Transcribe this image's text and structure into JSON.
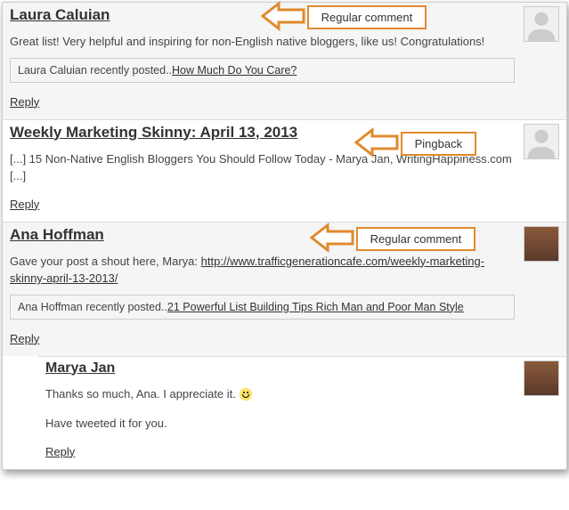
{
  "comments": [
    {
      "author": "Laura Caluian",
      "body": "Great list! Very helpful and inspiring for non-English native bloggers, like us! Congratulations!",
      "recent_prefix": "Laura Caluian recently posted..",
      "recent_link": "How Much Do You Care?",
      "reply": "Reply",
      "avatar": "blank",
      "callout": "Regular comment"
    },
    {
      "author": "Weekly Marketing Skinny: April 13, 2013",
      "body": "[...] 15 Non-Native English Bloggers You Should Follow Today - Marya Jan, WritingHappiness.com [...]",
      "reply": "Reply",
      "avatar": "blank",
      "callout": "Pingback"
    },
    {
      "author": "Ana Hoffman",
      "body_pre": "Gave your post a shout here, Marya: ",
      "body_link": "http://www.trafficgenerationcafe.com/weekly-marketing-skinny-april-13-2013/",
      "recent_prefix": "Ana Hoffman recently posted..",
      "recent_link": "21 Powerful List Building Tips Rich Man and Poor Man Style",
      "reply": "Reply",
      "avatar": "female",
      "callout": "Regular comment"
    },
    {
      "author": "Marya Jan",
      "body1": "Thanks so much, Ana. I appreciate it. ",
      "body2": "Have tweeted it for you.",
      "reply": "Reply",
      "avatar": "female"
    }
  ]
}
